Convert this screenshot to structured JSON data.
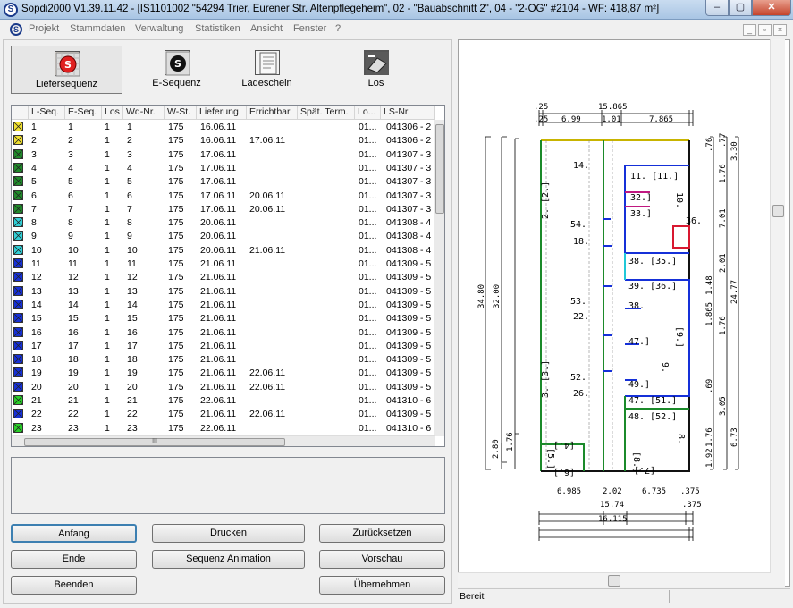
{
  "window": {
    "title": "Sopdi2000 V1.39.11.42 - [IS1101002 \"54294 Trier, Eurener Str. Altenpflegeheim\", 02 -  \"Bauabschnitt 2\", 04 - \"2-OG\" #2104 - WF: 418,87 m²]",
    "app_icon": "S",
    "minimize": "–",
    "maximize": "▢",
    "close": "✕"
  },
  "menu": [
    "Projekt",
    "Stammdaten",
    "Verwaltung",
    "Statistiken",
    "Ansicht",
    "Fenster",
    "?"
  ],
  "mdi_buttons": [
    "_",
    "▫",
    "×"
  ],
  "toolbar": {
    "liefersequenz": "Liefersequenz",
    "esequenz": "E-Sequenz",
    "ladeschein": "Ladeschein",
    "los": "Los"
  },
  "table": {
    "headers": [
      "L-Seq.",
      "E-Seq.",
      "Los",
      "Wd-Nr.",
      "W-St.",
      "Lieferung",
      "Errichtbar",
      "Spät. Term.",
      "Lo...",
      "LS-Nr."
    ],
    "rows": [
      {
        "color": "#f0e030",
        "l": "1",
        "e": "1",
        "los": "1",
        "wd": "1",
        "wst": "175",
        "lief": "16.06.11",
        "err": "",
        "lo": "01...",
        "ls": "041306 - 2"
      },
      {
        "color": "#f0e030",
        "l": "2",
        "e": "2",
        "los": "1",
        "wd": "2",
        "wst": "175",
        "lief": "16.06.11",
        "err": "17.06.11",
        "lo": "01...",
        "ls": "041306 - 2"
      },
      {
        "color": "#1f8a2a",
        "l": "3",
        "e": "3",
        "los": "1",
        "wd": "3",
        "wst": "175",
        "lief": "17.06.11",
        "err": "",
        "lo": "01...",
        "ls": "041307 - 3"
      },
      {
        "color": "#1f8a2a",
        "l": "4",
        "e": "4",
        "los": "1",
        "wd": "4",
        "wst": "175",
        "lief": "17.06.11",
        "err": "",
        "lo": "01...",
        "ls": "041307 - 3"
      },
      {
        "color": "#1f8a2a",
        "l": "5",
        "e": "5",
        "los": "1",
        "wd": "5",
        "wst": "175",
        "lief": "17.06.11",
        "err": "",
        "lo": "01...",
        "ls": "041307 - 3"
      },
      {
        "color": "#1f8a2a",
        "l": "6",
        "e": "6",
        "los": "1",
        "wd": "6",
        "wst": "175",
        "lief": "17.06.11",
        "err": "20.06.11",
        "lo": "01...",
        "ls": "041307 - 3"
      },
      {
        "color": "#1f8a2a",
        "l": "7",
        "e": "7",
        "los": "1",
        "wd": "7",
        "wst": "175",
        "lief": "17.06.11",
        "err": "20.06.11",
        "lo": "01...",
        "ls": "041307 - 3"
      },
      {
        "color": "#30d0d8",
        "l": "8",
        "e": "8",
        "los": "1",
        "wd": "8",
        "wst": "175",
        "lief": "20.06.11",
        "err": "",
        "lo": "01...",
        "ls": "041308 - 4"
      },
      {
        "color": "#30d0d8",
        "l": "9",
        "e": "9",
        "los": "1",
        "wd": "9",
        "wst": "175",
        "lief": "20.06.11",
        "err": "",
        "lo": "01...",
        "ls": "041308 - 4"
      },
      {
        "color": "#30d0d8",
        "l": "10",
        "e": "10",
        "los": "1",
        "wd": "10",
        "wst": "175",
        "lief": "20.06.11",
        "err": "21.06.11",
        "lo": "01...",
        "ls": "041308 - 4"
      },
      {
        "color": "#1530d8",
        "l": "11",
        "e": "11",
        "los": "1",
        "wd": "11",
        "wst": "175",
        "lief": "21.06.11",
        "err": "",
        "lo": "01...",
        "ls": "041309 - 5"
      },
      {
        "color": "#1530d8",
        "l": "12",
        "e": "12",
        "los": "1",
        "wd": "12",
        "wst": "175",
        "lief": "21.06.11",
        "err": "",
        "lo": "01...",
        "ls": "041309 - 5"
      },
      {
        "color": "#1530d8",
        "l": "13",
        "e": "13",
        "los": "1",
        "wd": "13",
        "wst": "175",
        "lief": "21.06.11",
        "err": "",
        "lo": "01...",
        "ls": "041309 - 5"
      },
      {
        "color": "#1530d8",
        "l": "14",
        "e": "14",
        "los": "1",
        "wd": "14",
        "wst": "175",
        "lief": "21.06.11",
        "err": "",
        "lo": "01...",
        "ls": "041309 - 5"
      },
      {
        "color": "#1530d8",
        "l": "15",
        "e": "15",
        "los": "1",
        "wd": "15",
        "wst": "175",
        "lief": "21.06.11",
        "err": "",
        "lo": "01...",
        "ls": "041309 - 5"
      },
      {
        "color": "#1530d8",
        "l": "16",
        "e": "16",
        "los": "1",
        "wd": "16",
        "wst": "175",
        "lief": "21.06.11",
        "err": "",
        "lo": "01...",
        "ls": "041309 - 5"
      },
      {
        "color": "#1530d8",
        "l": "17",
        "e": "17",
        "los": "1",
        "wd": "17",
        "wst": "175",
        "lief": "21.06.11",
        "err": "",
        "lo": "01...",
        "ls": "041309 - 5"
      },
      {
        "color": "#1530d8",
        "l": "18",
        "e": "18",
        "los": "1",
        "wd": "18",
        "wst": "175",
        "lief": "21.06.11",
        "err": "",
        "lo": "01...",
        "ls": "041309 - 5"
      },
      {
        "color": "#1530d8",
        "l": "19",
        "e": "19",
        "los": "1",
        "wd": "19",
        "wst": "175",
        "lief": "21.06.11",
        "err": "22.06.11",
        "lo": "01...",
        "ls": "041309 - 5"
      },
      {
        "color": "#1530d8",
        "l": "20",
        "e": "20",
        "los": "1",
        "wd": "20",
        "wst": "175",
        "lief": "21.06.11",
        "err": "22.06.11",
        "lo": "01...",
        "ls": "041309 - 5"
      },
      {
        "color": "#28d028",
        "l": "21",
        "e": "21",
        "los": "1",
        "wd": "21",
        "wst": "175",
        "lief": "22.06.11",
        "err": "",
        "lo": "01...",
        "ls": "041310 - 6"
      },
      {
        "color": "#1530d8",
        "l": "22",
        "e": "22",
        "los": "1",
        "wd": "22",
        "wst": "175",
        "lief": "21.06.11",
        "err": "22.06.11",
        "lo": "01...",
        "ls": "041309 - 5"
      },
      {
        "color": "#28d028",
        "l": "23",
        "e": "23",
        "los": "1",
        "wd": "23",
        "wst": "175",
        "lief": "22.06.11",
        "err": "",
        "lo": "01...",
        "ls": "041310 - 6"
      }
    ],
    "hscroll_grip": "III"
  },
  "buttons": {
    "anfang": "Anfang",
    "drucken": "Drucken",
    "zuruecksetzen": "Zurücksetzen",
    "ende": "Ende",
    "sequenz_animation": "Sequenz Animation",
    "vorschau": "Vorschau",
    "beenden": "Beenden",
    "uebernehmen": "Übernehmen"
  },
  "status": {
    "text": "Bereit"
  },
  "plan": {
    "dims_top": [
      ".25",
      "15.865",
      ".25",
      "6.99",
      "1.01",
      "7.865"
    ],
    "dims_bottom": [
      "6.985",
      "2.02",
      "6.735",
      ".375",
      "15.74",
      ".375",
      "16.115"
    ],
    "dims_left": [
      "34.80",
      "32.00",
      "1.76",
      "2.80"
    ],
    "dims_right": [
      ".76",
      ".77",
      "3.30",
      "1.76",
      "7.01",
      "2.01",
      "24.77",
      "1.48",
      "1.865",
      "1.76",
      ".69",
      "3.05",
      "6.73",
      "1.76",
      "1.92"
    ],
    "rooms": [
      "11. [11.]",
      "32.]",
      "33.]",
      "36.",
      "38. [35.]",
      "39. [36.]",
      "38.",
      "47.]",
      "49.]",
      "47. [51.]",
      "48. [52.]",
      "[8.]",
      "8.",
      "[7.]",
      "[4.]",
      "[6.]",
      "[5.]",
      "54.",
      "53.",
      "52.",
      "14.",
      "18.",
      "22.",
      "26.",
      "2. [2.]",
      "3. [3.]",
      "[9.]",
      "9.",
      "10."
    ]
  }
}
